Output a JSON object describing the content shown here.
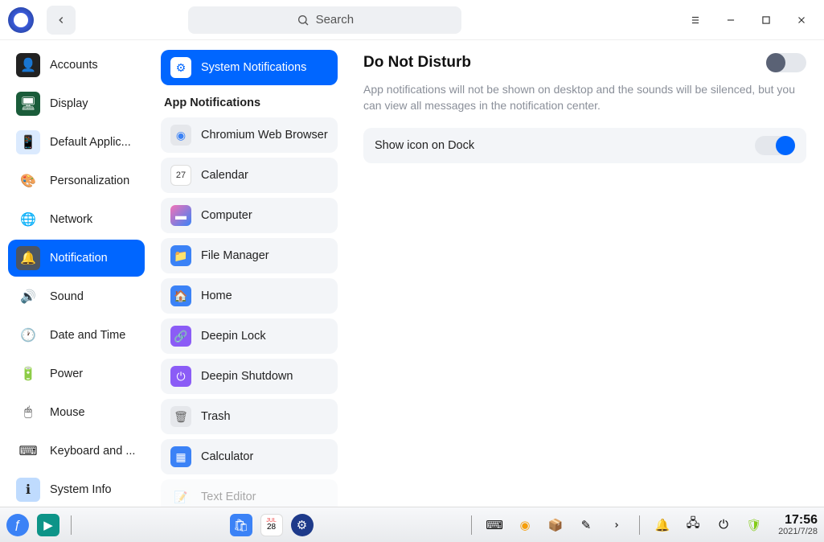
{
  "search": {
    "placeholder": "Search"
  },
  "sidebar": {
    "items": [
      {
        "label": "Accounts",
        "icon": "accounts"
      },
      {
        "label": "Display",
        "icon": "display"
      },
      {
        "label": "Default Applic...",
        "icon": "default-apps"
      },
      {
        "label": "Personalization",
        "icon": "personalization"
      },
      {
        "label": "Network",
        "icon": "network"
      },
      {
        "label": "Notification",
        "icon": "notification",
        "active": true
      },
      {
        "label": "Sound",
        "icon": "sound"
      },
      {
        "label": "Date and Time",
        "icon": "datetime"
      },
      {
        "label": "Power",
        "icon": "power"
      },
      {
        "label": "Mouse",
        "icon": "mouse"
      },
      {
        "label": "Keyboard and ...",
        "icon": "keyboard"
      },
      {
        "label": "System Info",
        "icon": "sysinfo"
      }
    ]
  },
  "middle": {
    "system_label": "System Notifications",
    "section_header": "App Notifications",
    "apps": [
      {
        "label": "Chromium Web Browser",
        "icon": "chromium"
      },
      {
        "label": "Calendar",
        "icon": "calendar"
      },
      {
        "label": "Computer",
        "icon": "computer"
      },
      {
        "label": "File Manager",
        "icon": "filemanager"
      },
      {
        "label": "Home",
        "icon": "home"
      },
      {
        "label": "Deepin Lock",
        "icon": "lock"
      },
      {
        "label": "Deepin Shutdown",
        "icon": "shutdown"
      },
      {
        "label": "Trash",
        "icon": "trash"
      },
      {
        "label": "Calculator",
        "icon": "calculator"
      },
      {
        "label": "Text Editor",
        "icon": "editor"
      }
    ]
  },
  "content": {
    "title": "Do Not Disturb",
    "description": "App notifications will not be shown on desktop and the sounds will be silenced, but you can view all messages in the notification center.",
    "show_icon_label": "Show icon on Dock",
    "dnd_enabled": false,
    "show_icon_enabled": true
  },
  "taskbar": {
    "time": "17:56",
    "date": "2021/7/28"
  }
}
